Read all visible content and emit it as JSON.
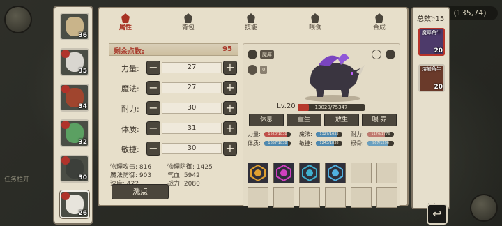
{
  "map": {
    "coordinate": "(135,74)",
    "side_label": "任务栏开"
  },
  "heroes": [
    {
      "level": "36",
      "face": "#c9b48a",
      "badge": false,
      "selected": false
    },
    {
      "level": "35",
      "face": "#d9d6d0",
      "badge": true,
      "selected": false
    },
    {
      "level": "34",
      "face": "#a0452e",
      "badge": true,
      "selected": false
    },
    {
      "level": "32",
      "face": "#5ba062",
      "badge": true,
      "selected": false
    },
    {
      "level": "30",
      "face": "#3c3f3a",
      "badge": true,
      "selected": false
    },
    {
      "level": "26",
      "face": "#e7e4dc",
      "badge": true,
      "selected": true
    }
  ],
  "tabs": [
    {
      "label": "属性",
      "icon": "flame-icon",
      "active": true
    },
    {
      "label": "背包",
      "icon": "backpack-icon",
      "active": false
    },
    {
      "label": "技能",
      "icon": "skill-icon",
      "active": false
    },
    {
      "label": "喂食",
      "icon": "food-icon",
      "active": false
    },
    {
      "label": "合成",
      "icon": "merge-icon",
      "active": false
    }
  ],
  "allocation": {
    "remaining_label": "剩余点数:",
    "remaining_value": "95",
    "stats": [
      {
        "label": "力量:",
        "value": "27"
      },
      {
        "label": "魔法:",
        "value": "27"
      },
      {
        "label": "耐力:",
        "value": "30"
      },
      {
        "label": "体质:",
        "value": "31"
      },
      {
        "label": "敏捷:",
        "value": "30"
      }
    ],
    "derived": [
      {
        "label": "物理攻击:",
        "value": "816"
      },
      {
        "label": "物理防御:",
        "value": "1425"
      },
      {
        "label": "魔法防御:",
        "value": "903"
      },
      {
        "label": "气血:",
        "value": "5942"
      },
      {
        "label": "速度:",
        "value": "422"
      },
      {
        "label": "战力:",
        "value": "2080"
      }
    ],
    "reset_label": "洗点"
  },
  "pet": {
    "name_tag": "魔犀",
    "star_value": "0",
    "level": "Lv.20",
    "exp_text": "13020/75347",
    "exp_fraction": 0.17,
    "actions": [
      "休息",
      "重生",
      "放生",
      "喂 养"
    ],
    "stats": [
      {
        "label": "力量:",
        "value_text": "1520/1838",
        "fill": 0.83,
        "color": "#c0504a"
      },
      {
        "label": "魔法:",
        "value_text": "1327/1633",
        "fill": 0.81,
        "color": "#4f89b0"
      },
      {
        "label": "耐力:",
        "value_text": "1176/1776",
        "fill": 0.66,
        "color": "#c07a70"
      },
      {
        "label": "体质:",
        "value_text": "1657/1838",
        "fill": 0.9,
        "color": "#4f89b0"
      },
      {
        "label": "敏捷:",
        "value_text": "1243/1838",
        "fill": 0.68,
        "color": "#4f89b0"
      },
      {
        "label": "根骨:",
        "value_text": "967/1296",
        "fill": 0.75,
        "color": "#6aa0c0"
      }
    ],
    "skills": [
      {
        "filled": true,
        "color": "#e0a030",
        "icon": "shield-skill-icon"
      },
      {
        "filled": true,
        "color": "#d040c0",
        "icon": "rune-skill-icon"
      },
      {
        "filled": true,
        "color": "#40b0d0",
        "icon": "ice-skill-icon"
      },
      {
        "filled": true,
        "color": "#50b0e0",
        "icon": "crystal-skill-icon"
      },
      {
        "filled": false
      },
      {
        "filled": false
      },
      {
        "filled": false
      },
      {
        "filled": false
      },
      {
        "filled": false
      },
      {
        "filled": false
      },
      {
        "filled": false
      },
      {
        "filled": false
      }
    ]
  },
  "pet_list": {
    "total_label": "总数: 15",
    "items": [
      {
        "name": "魔犀角牛",
        "level": "20",
        "selected": true,
        "color": "#4d3a6a"
      },
      {
        "name": "熔岩角牛",
        "level": "20",
        "selected": false,
        "color": "#6a3a2a"
      }
    ]
  }
}
